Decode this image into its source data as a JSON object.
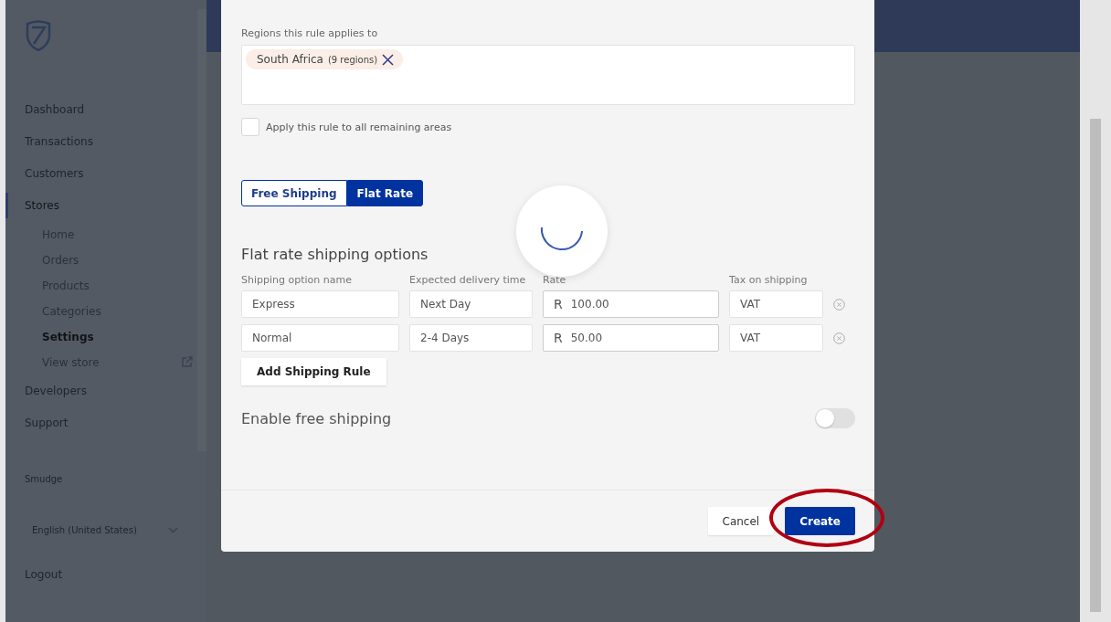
{
  "sidebar": {
    "nav": [
      {
        "label": "Dashboard",
        "selected": false
      },
      {
        "label": "Transactions",
        "selected": false
      },
      {
        "label": "Customers",
        "selected": false
      },
      {
        "label": "Stores",
        "selected": true,
        "children": [
          {
            "label": "Home",
            "selected": false,
            "kind": "page"
          },
          {
            "label": "Orders",
            "selected": false,
            "kind": "page"
          },
          {
            "label": "Products",
            "selected": false,
            "kind": "page"
          },
          {
            "label": "Categories",
            "selected": false,
            "kind": "page"
          },
          {
            "label": "Settings",
            "selected": true,
            "kind": "page"
          },
          {
            "label": "View store",
            "selected": false,
            "kind": "external"
          }
        ]
      },
      {
        "label": "Developers",
        "selected": false
      },
      {
        "label": "Support",
        "selected": false
      }
    ],
    "user_name": "Smudge",
    "language": "English (United States)",
    "logout": "Logout"
  },
  "modal": {
    "regions_label": "Regions this rule applies to",
    "region_tags": [
      {
        "name": "South Africa",
        "count": "(9 regions)"
      }
    ],
    "apply_all": {
      "label": "Apply this rule to all remaining areas",
      "checked": false
    },
    "shipping_type": [
      {
        "label": "Free Shipping",
        "selected": false
      },
      {
        "label": "Flat Rate",
        "selected": true
      }
    ],
    "section_title": "Flat rate shipping options",
    "columns": [
      "Shipping option name",
      "Expected delivery time",
      "Rate",
      "Tax on shipping"
    ],
    "options": [
      {
        "name": "Express",
        "delivery": "Next Day",
        "currency": "R",
        "rate": "100.00",
        "tax": "VAT"
      },
      {
        "name": "Normal",
        "delivery": "2-4 Days",
        "currency": "R",
        "rate": "50.00",
        "tax": "VAT"
      }
    ],
    "add_button": "Add Shipping Rule",
    "free_shipping": {
      "label": "Enable free shipping",
      "on": false
    },
    "buttons": [
      {
        "label": "Cancel",
        "kind": "secondary"
      },
      {
        "label": "Create",
        "kind": "primary"
      }
    ]
  }
}
